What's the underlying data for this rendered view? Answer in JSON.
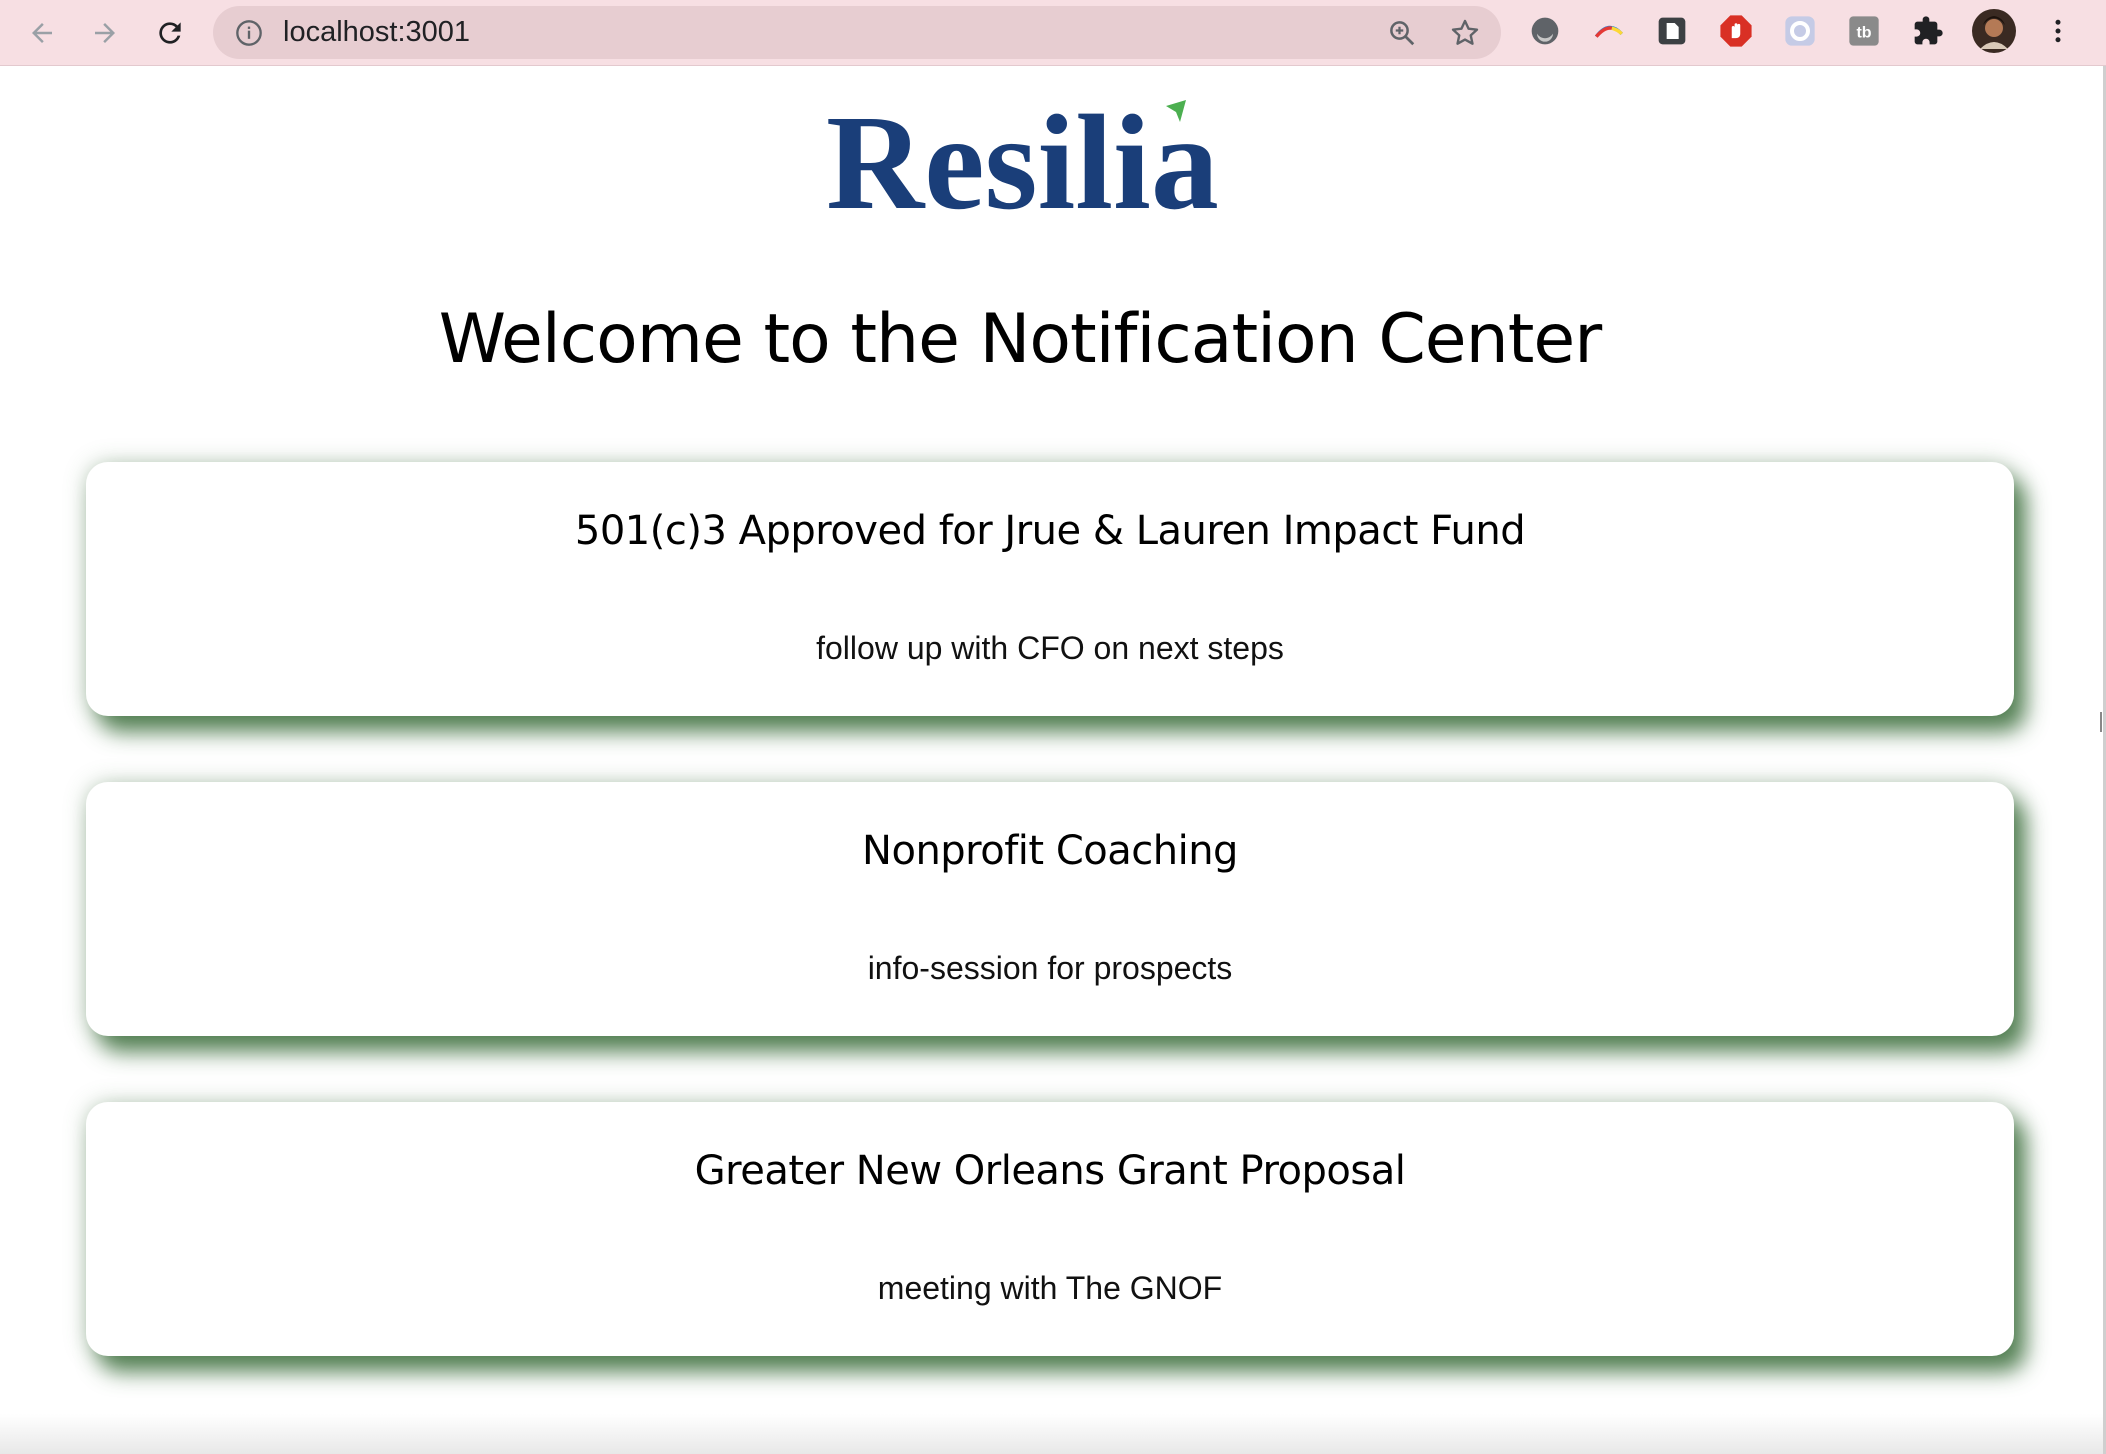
{
  "browser": {
    "url": "localhost:3001",
    "colors": {
      "chrome_bg": "#f7dfe3",
      "omnibox_bg": "#e7cdd1"
    },
    "extensions": [
      "moon-extension-icon",
      "rainbow-arc-extension-icon",
      "document-extension-icon",
      "stop-hand-extension-icon",
      "circle-extension-icon",
      "tb-extension-icon",
      "puzzle-extensions-icon",
      "profile-avatar",
      "more-menu-icon"
    ]
  },
  "page": {
    "logo_text": "Resilia",
    "title": "Welcome to the Notification Center",
    "colors": {
      "logo": "#1a3e79",
      "logo_accent": "#4caf50",
      "card_shadow": "#3c6e3c"
    },
    "notifications": [
      {
        "title": "501(c)3 Approved for Jrue & Lauren Impact Fund",
        "body": "follow up with CFO on next steps"
      },
      {
        "title": "Nonprofit Coaching",
        "body": "info-session for prospects"
      },
      {
        "title": "Greater New Orleans Grant Proposal",
        "body": "meeting with The GNOF"
      }
    ]
  }
}
